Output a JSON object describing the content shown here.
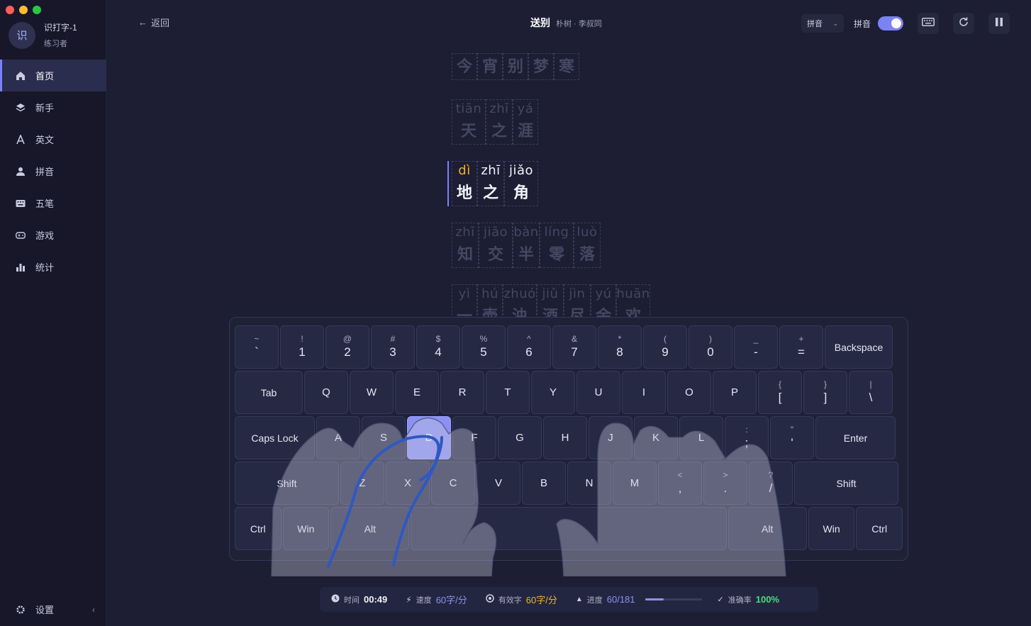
{
  "window": {
    "traffic": [
      "#ff5f57",
      "#febc2e",
      "#28c840"
    ]
  },
  "profile": {
    "avatar_text": "识",
    "name": "识打字-1",
    "role": "练习者"
  },
  "sidebar": {
    "items": [
      {
        "label": "首页",
        "icon": "home-icon",
        "active": true
      },
      {
        "label": "新手",
        "icon": "layers-icon",
        "active": false
      },
      {
        "label": "英文",
        "icon": "letter-a-icon",
        "active": false
      },
      {
        "label": "拼音",
        "icon": "user-icon",
        "active": false
      },
      {
        "label": "五笔",
        "icon": "keyboard-icon",
        "active": false
      },
      {
        "label": "游戏",
        "icon": "gamepad-icon",
        "active": false
      },
      {
        "label": "统计",
        "icon": "bar-chart-icon",
        "active": false
      }
    ],
    "settings_label": "设置",
    "collapse_label": "‹"
  },
  "header": {
    "back_label": "返回",
    "title": "送别",
    "author": "朴树 · 李叔同",
    "select_value": "拼音",
    "toggle_label": "拼音",
    "toggle_on": true
  },
  "poem": {
    "lines": [
      {
        "state": "dim",
        "chars": [
          {
            "py": "",
            "hz": "今"
          },
          {
            "py": "",
            "hz": "宵"
          },
          {
            "py": "",
            "hz": "别"
          },
          {
            "py": "",
            "hz": "梦"
          },
          {
            "py": "",
            "hz": "寒"
          }
        ]
      },
      {
        "state": "dim",
        "chars": [
          {
            "py": "tiān",
            "hz": "天"
          },
          {
            "py": "zhī",
            "hz": "之"
          },
          {
            "py": "yá",
            "hz": "涯"
          }
        ]
      },
      {
        "state": "current",
        "chars": [
          {
            "py": "dì",
            "hz": "地"
          },
          {
            "py": "zhī",
            "hz": "之"
          },
          {
            "py": "jiǎo",
            "hz": "角"
          }
        ]
      },
      {
        "state": "dim",
        "chars": [
          {
            "py": "zhī",
            "hz": "知"
          },
          {
            "py": "jiāo",
            "hz": "交"
          },
          {
            "py": "bàn",
            "hz": "半"
          },
          {
            "py": "líng",
            "hz": "零"
          },
          {
            "py": "luò",
            "hz": "落"
          }
        ]
      },
      {
        "state": "dim",
        "chars": [
          {
            "py": "yì",
            "hz": "一"
          },
          {
            "py": "hú",
            "hz": "壶"
          },
          {
            "py": "zhuó",
            "hz": "浊"
          },
          {
            "py": "jiǔ",
            "hz": "酒"
          },
          {
            "py": "jìn",
            "hz": "尽"
          },
          {
            "py": "yú",
            "hz": "余"
          },
          {
            "py": "huān",
            "hz": "欢"
          }
        ]
      }
    ],
    "active_char": 0
  },
  "keyboard": {
    "rows": [
      [
        {
          "s": "~",
          "m": "`"
        },
        {
          "s": "!",
          "m": "1"
        },
        {
          "s": "@",
          "m": "2"
        },
        {
          "s": "#",
          "m": "3"
        },
        {
          "s": "$",
          "m": "4"
        },
        {
          "s": "%",
          "m": "5"
        },
        {
          "s": "^",
          "m": "6"
        },
        {
          "s": "&",
          "m": "7"
        },
        {
          "s": "*",
          "m": "8"
        },
        {
          "s": "(",
          "m": "9"
        },
        {
          "s": ")",
          "m": "0"
        },
        {
          "s": "_",
          "m": "-"
        },
        {
          "s": "+",
          "m": "="
        },
        {
          "s": "",
          "m": "Backspace"
        }
      ],
      [
        {
          "s": "",
          "m": "Tab"
        },
        {
          "s": "",
          "m": "Q"
        },
        {
          "s": "",
          "m": "W"
        },
        {
          "s": "",
          "m": "E"
        },
        {
          "s": "",
          "m": "R"
        },
        {
          "s": "",
          "m": "T"
        },
        {
          "s": "",
          "m": "Y"
        },
        {
          "s": "",
          "m": "U"
        },
        {
          "s": "",
          "m": "I"
        },
        {
          "s": "",
          "m": "O"
        },
        {
          "s": "",
          "m": "P"
        },
        {
          "s": "{",
          "m": "["
        },
        {
          "s": "}",
          "m": "]"
        },
        {
          "s": "|",
          "m": "\\"
        }
      ],
      [
        {
          "s": "",
          "m": "Caps Lock"
        },
        {
          "s": "",
          "m": "A"
        },
        {
          "s": "",
          "m": "S"
        },
        {
          "s": "",
          "m": "D"
        },
        {
          "s": "",
          "m": "F"
        },
        {
          "s": "",
          "m": "G"
        },
        {
          "s": "",
          "m": "H"
        },
        {
          "s": "",
          "m": "J"
        },
        {
          "s": "",
          "m": "K"
        },
        {
          "s": "",
          "m": "L"
        },
        {
          "s": ":",
          "m": ";"
        },
        {
          "s": "\"",
          "m": "'"
        },
        {
          "s": "",
          "m": "Enter"
        }
      ],
      [
        {
          "s": "",
          "m": "Shift"
        },
        {
          "s": "",
          "m": "Z"
        },
        {
          "s": "",
          "m": "X"
        },
        {
          "s": "",
          "m": "C"
        },
        {
          "s": "",
          "m": "V"
        },
        {
          "s": "",
          "m": "B"
        },
        {
          "s": "",
          "m": "N"
        },
        {
          "s": "",
          "m": "M"
        },
        {
          "s": "<",
          "m": ","
        },
        {
          "s": ">",
          "m": "."
        },
        {
          "s": "?",
          "m": "/"
        },
        {
          "s": "",
          "m": "Shift"
        }
      ],
      [
        {
          "s": "",
          "m": "Ctrl"
        },
        {
          "s": "",
          "m": "Win"
        },
        {
          "s": "",
          "m": "Alt"
        },
        {
          "s": "",
          "m": ""
        },
        {
          "s": "",
          "m": "Alt"
        },
        {
          "s": "",
          "m": "Win"
        },
        {
          "s": "",
          "m": "Ctrl"
        }
      ]
    ],
    "highlight": "D",
    "accent": "#8b91f3"
  },
  "stats": {
    "time_label": "时间",
    "time": "00:49",
    "speed_label": "速度",
    "speed": "60字/分",
    "eff_label": "有效字",
    "eff": "60字/分",
    "progress_label": "进度",
    "progress": "60/181",
    "progress_ratio": 0.33,
    "acc_label": "准确率",
    "acc": "100%"
  },
  "colors": {
    "speed": "#8b91f3",
    "eff": "#f0b429",
    "progress": "#8b91f3",
    "acc": "#4ade80"
  }
}
